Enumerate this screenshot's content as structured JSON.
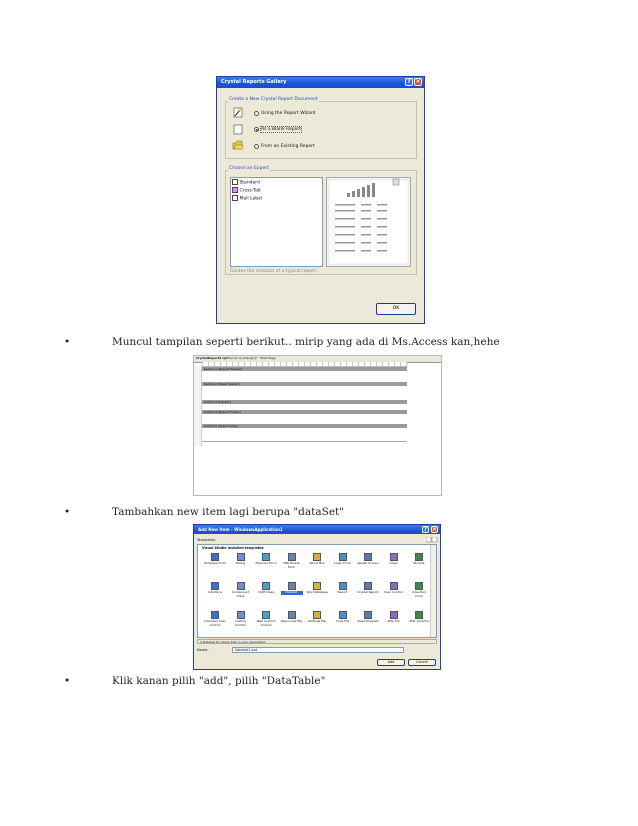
{
  "bullets": [
    "Muncul tampilan seperti berikut.. mirip yang ada di Ms.Access kan,hehe",
    "Tambahkan new item lagi berupa \"dataSet\"",
    "Klik kanan pilih \"add\", pilih \"DataTable\""
  ],
  "bullet_symbol": "•",
  "gallery": {
    "title": "Crystal Reports Gallery",
    "group_create": "Create a New Crystal Report Document",
    "options": [
      "Using the Report Wizard",
      "As a Blank Report",
      "From an Existing Report"
    ],
    "selected_option": "As a Blank Report",
    "group_expert": "Choose an Expert",
    "experts": [
      "Standard",
      "Cross-Tab",
      "Mail Label"
    ],
    "description": "Guides the creation of a typical report.",
    "ok_label": "OK"
  },
  "designer": {
    "tabs": [
      "CrystalReport1.rpt",
      "Form1.vb [Design]*",
      "Start Page"
    ],
    "sections": [
      "Section1 (Report Header)",
      "Section2 (Page Header)",
      "Section3 (Details)",
      "Section4 (Report Footer)",
      "Section5 (Page Footer)"
    ]
  },
  "add_item": {
    "title": "Add New Item - WindowsApplication1",
    "templates_label": "Templates:",
    "group_label": "Visual Studio installed templates",
    "items": [
      "Windows Form",
      "Dialog",
      "Explorer Form",
      "MDI Parent Form",
      "About Box",
      "Login Form",
      "Splash Screen",
      "Class",
      "Module",
      "Interface",
      "Component Class",
      "COM Class",
      "DataSet",
      "SQL Database",
      "Report",
      "Crystal Report",
      "User Control",
      "Inherited Form",
      "Inherited User Control",
      "Custom Control",
      "Web Custom Control",
      "Resources File",
      "Settings File",
      "Code File",
      "Class Diagram",
      "XML File",
      "XML Schema"
    ],
    "selected_item": "DataSet",
    "description": "A DataSet for using data in your application",
    "name_label": "Name:",
    "name_value": "DataSet1.xsd",
    "add_label": "Add",
    "cancel_label": "Cancel"
  },
  "colors": {
    "xp_title": "#1b56d8",
    "xp_face": "#ece9d8",
    "section_bar": "#9a9a9a",
    "link_blue": "#1a4cc4"
  }
}
